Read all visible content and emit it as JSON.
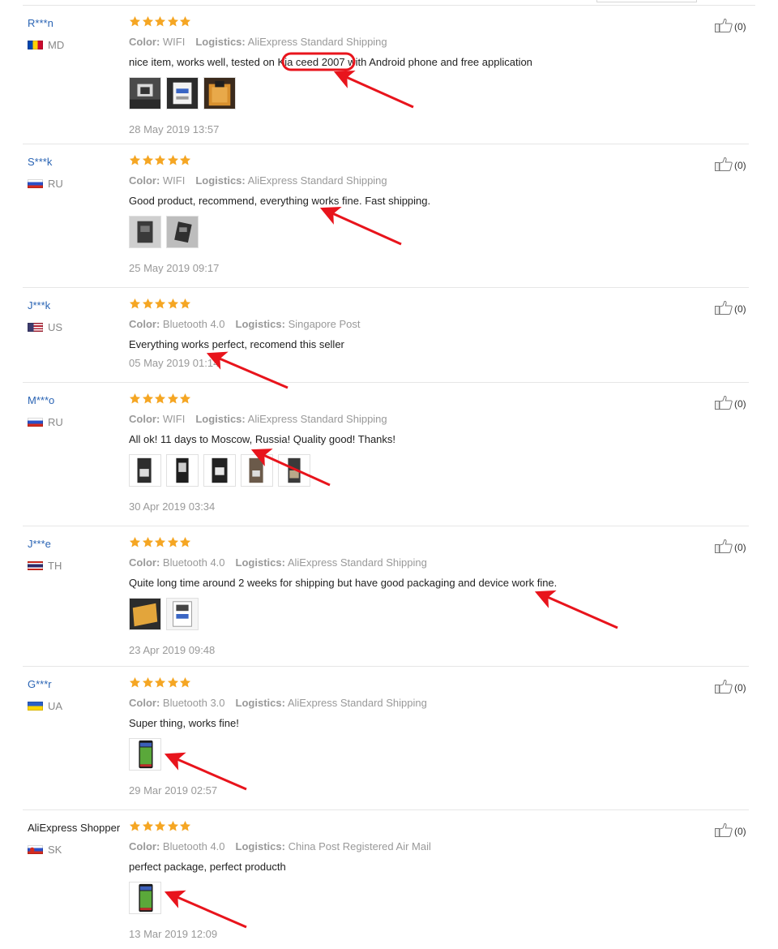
{
  "labels": {
    "color": "Color:",
    "logistics": "Logistics:"
  },
  "reviews": [
    {
      "user": "R***n",
      "country": "MD",
      "color": "WIFI",
      "logistics": "AliExpress Standard Shipping",
      "text": "nice item, works well, tested on Kia ceed 2007 with Android phone and free application",
      "date": "28 May 2019 13:57",
      "likes": "(0)",
      "rating": 5,
      "photos": 3
    },
    {
      "user": "S***k",
      "country": "RU",
      "color": "WIFI",
      "logistics": "AliExpress Standard Shipping",
      "text": "Good product, recommend, everything works fine. Fast shipping.",
      "date": "25 May 2019 09:17",
      "likes": "(0)",
      "rating": 5,
      "photos": 2
    },
    {
      "user": "J***k",
      "country": "US",
      "color": "Bluetooth 4.0",
      "logistics": "Singapore Post",
      "text": "Everything works perfect, recomend this seller",
      "date": "05 May 2019 01:14",
      "likes": "(0)",
      "rating": 5,
      "photos": 0
    },
    {
      "user": "M***o",
      "country": "RU",
      "color": "WIFI",
      "logistics": "AliExpress Standard Shipping",
      "text": "All ok! 11 days to Moscow, Russia! Quality good! Thanks!",
      "date": "30 Apr 2019 03:34",
      "likes": "(0)",
      "rating": 5,
      "photos": 5
    },
    {
      "user": "J***e",
      "country": "TH",
      "color": "Bluetooth 4.0",
      "logistics": "AliExpress Standard Shipping",
      "text": "Quite long time around 2 weeks for shipping but have good packaging and device work fine.",
      "date": "23 Apr 2019 09:48",
      "likes": "(0)",
      "rating": 5,
      "photos": 2
    },
    {
      "user": "G***r",
      "country": "UA",
      "color": "Bluetooth 3.0",
      "logistics": "AliExpress Standard Shipping",
      "text": "Super thing, works fine!",
      "date": "29 Mar 2019 02:57",
      "likes": "(0)",
      "rating": 5,
      "photos": 1
    },
    {
      "user": "AliExpress Shopper",
      "country": "SK",
      "color": "Bluetooth 4.0",
      "logistics": "China Post Registered Air Mail",
      "text": "perfect package, perfect producth",
      "date": "13 Mar 2019 12:09",
      "likes": "(0)",
      "rating": 5,
      "photos": 1
    }
  ],
  "colors": {
    "star": "#f5a623",
    "username": "#2a64b4",
    "annotation": "#e8141c",
    "muted": "#999999"
  },
  "icons": {
    "like": "thumbs-up-icon",
    "star": "star-icon",
    "annotation": "red-arrow-icon"
  }
}
